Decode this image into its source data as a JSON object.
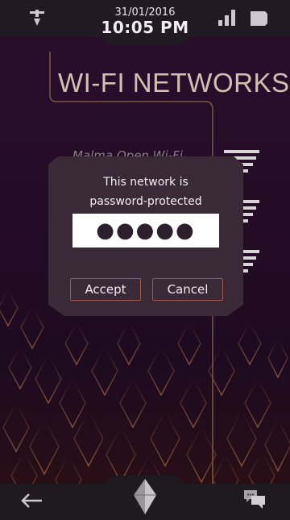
{
  "status_bar": {
    "date": "31/01/2016",
    "time": "10:05 PM",
    "icons": [
      "notification-icon",
      "signal-icon",
      "battery-icon"
    ]
  },
  "header": {
    "title": "WI-FI NETWORKS"
  },
  "networks": [
    {
      "name": "Malma Open Wi-Fi"
    }
  ],
  "dialog": {
    "message_line1": "This network is",
    "message_line2": "password-protected",
    "password_value": "●●●●●",
    "accept_label": "Accept",
    "cancel_label": "Cancel"
  },
  "bottom_nav": {
    "icons": [
      "back-arrow-icon",
      "home-crystal-icon",
      "chat-icon"
    ]
  },
  "colors": {
    "background": "#220c24",
    "title": "#d3c0ae",
    "dialog": "#3a2a38",
    "button_border": "#9b5a4c"
  }
}
